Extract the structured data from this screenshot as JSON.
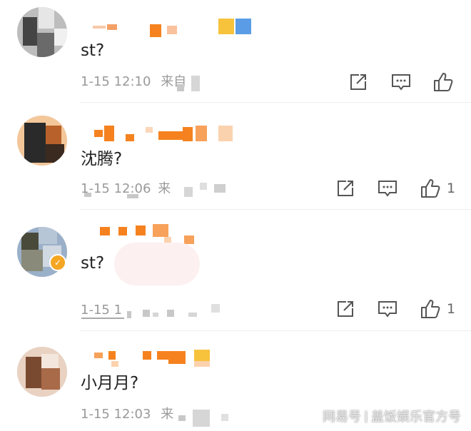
{
  "comments": [
    {
      "text": "st?",
      "time": "1-15 12:10",
      "source_prefix": "来自",
      "likes": ""
    },
    {
      "text": "沈腾?",
      "time": "1-15 12:06",
      "source_prefix": "来",
      "likes": "1"
    },
    {
      "text": "st?",
      "time": "1-15 1",
      "source_prefix": "",
      "likes": "1"
    },
    {
      "text": "小月月?",
      "time": "1-15 12:03",
      "source_prefix": "来",
      "likes": ""
    }
  ],
  "icons": {
    "share": "share-icon",
    "comment": "comment-icon",
    "like": "thumbs-up-icon"
  },
  "colors": {
    "accent_orange": "#f5821f",
    "verified_badge": "#f5a623",
    "text": "#222222",
    "meta": "#9a9a9a"
  },
  "watermark": {
    "platform": "网易号",
    "account": "盖饭娱乐官方号"
  }
}
